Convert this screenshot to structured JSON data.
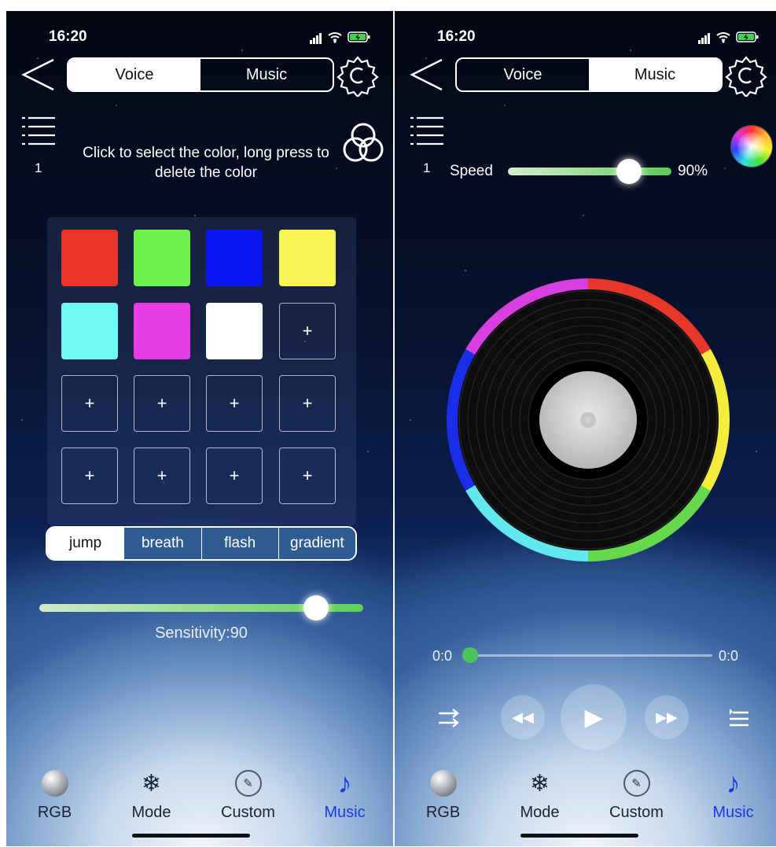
{
  "left": {
    "status": {
      "time": "16:20"
    },
    "segment": {
      "voice": "Voice",
      "music": "Music",
      "active": "voice"
    },
    "playlist_number": "1",
    "hint": "Click to select the color, long press to delete the color",
    "swatches": [
      {
        "color": "#e83528"
      },
      {
        "color": "#6ef04a"
      },
      {
        "color": "#0b16f2"
      },
      {
        "color": "#f8f552"
      },
      {
        "color": "#6ef8f6"
      },
      {
        "color": "#e83ce5"
      },
      {
        "color": "#ffffff"
      }
    ],
    "add_symbol": "+",
    "modes": [
      "jump",
      "breath",
      "flash",
      "gradient"
    ],
    "active_mode": "jump",
    "sensitivity_text": "Sensitivity:90",
    "sensitivity_value": 90
  },
  "right": {
    "status": {
      "time": "16:20"
    },
    "segment": {
      "voice": "Voice",
      "music": "Music",
      "active": "music"
    },
    "playlist_number": "1",
    "speed": {
      "label": "Speed",
      "percent_text": "90%",
      "value": 90
    },
    "progress": {
      "start": "0:0",
      "end": "0:0",
      "value": 0
    },
    "ring_colors": [
      "#e8362a",
      "#f6ec3c",
      "#66d84c",
      "#63e8f0",
      "#1a2de8",
      "#d83ee0"
    ]
  },
  "tabs": [
    {
      "label": "RGB",
      "icon": "rgb-knob-icon"
    },
    {
      "label": "Mode",
      "icon": "snowflake-icon"
    },
    {
      "label": "Custom",
      "icon": "edit-icon"
    },
    {
      "label": "Music",
      "icon": "music-note-icon"
    }
  ],
  "colors": {
    "accent": "#1a39e6",
    "tab_text": "#1b2230"
  }
}
